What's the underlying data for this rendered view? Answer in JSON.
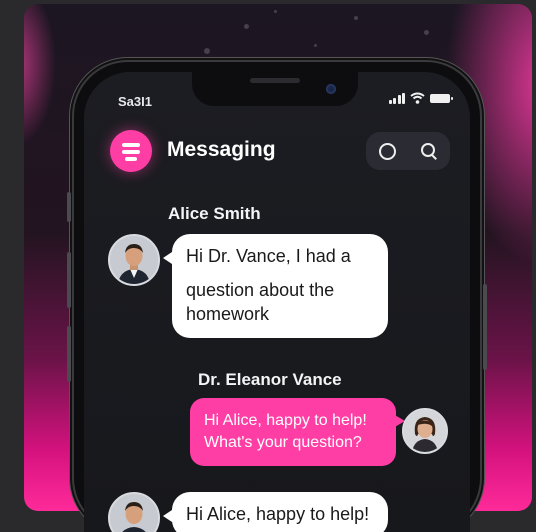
{
  "status_bar": {
    "time": "Sa3I1"
  },
  "app": {
    "title": "Messaging"
  },
  "messages": [
    {
      "sender": "Alice Smith",
      "text_lines": [
        "Hi Dr. Vance, I had a",
        "question about the",
        "homework"
      ]
    },
    {
      "sender": "Dr. Eleanor Vance",
      "text_lines": [
        "Hi Alice, happy to help!",
        "What's your question?"
      ]
    },
    {
      "sender": "",
      "text_lines": [
        "Hi Alice, happy to help!"
      ]
    }
  ],
  "colors": {
    "accent": "#ff3ea5",
    "screen_bg": "#1b1c21",
    "bubble_in": "#ffffff"
  },
  "icons": [
    "app-logo-icon",
    "circle-icon",
    "search-icon",
    "signal-icon",
    "wifi-icon",
    "battery-icon"
  ]
}
